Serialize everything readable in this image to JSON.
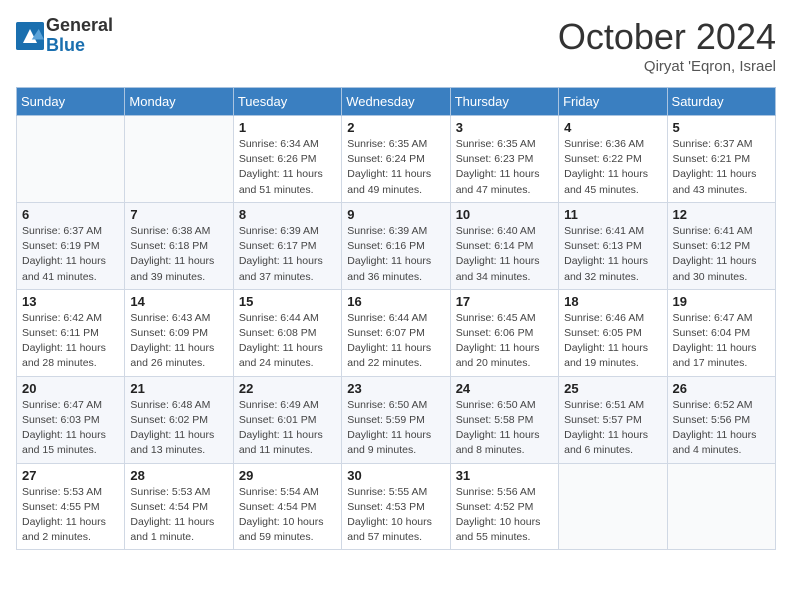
{
  "header": {
    "logo_line1": "General",
    "logo_line2": "Blue",
    "month_title": "October 2024",
    "subtitle": "Qiryat 'Eqron, Israel"
  },
  "days_of_week": [
    "Sunday",
    "Monday",
    "Tuesday",
    "Wednesday",
    "Thursday",
    "Friday",
    "Saturday"
  ],
  "weeks": [
    [
      {
        "day": "",
        "info": ""
      },
      {
        "day": "",
        "info": ""
      },
      {
        "day": "1",
        "info": "Sunrise: 6:34 AM\nSunset: 6:26 PM\nDaylight: 11 hours and 51 minutes."
      },
      {
        "day": "2",
        "info": "Sunrise: 6:35 AM\nSunset: 6:24 PM\nDaylight: 11 hours and 49 minutes."
      },
      {
        "day": "3",
        "info": "Sunrise: 6:35 AM\nSunset: 6:23 PM\nDaylight: 11 hours and 47 minutes."
      },
      {
        "day": "4",
        "info": "Sunrise: 6:36 AM\nSunset: 6:22 PM\nDaylight: 11 hours and 45 minutes."
      },
      {
        "day": "5",
        "info": "Sunrise: 6:37 AM\nSunset: 6:21 PM\nDaylight: 11 hours and 43 minutes."
      }
    ],
    [
      {
        "day": "6",
        "info": "Sunrise: 6:37 AM\nSunset: 6:19 PM\nDaylight: 11 hours and 41 minutes."
      },
      {
        "day": "7",
        "info": "Sunrise: 6:38 AM\nSunset: 6:18 PM\nDaylight: 11 hours and 39 minutes."
      },
      {
        "day": "8",
        "info": "Sunrise: 6:39 AM\nSunset: 6:17 PM\nDaylight: 11 hours and 37 minutes."
      },
      {
        "day": "9",
        "info": "Sunrise: 6:39 AM\nSunset: 6:16 PM\nDaylight: 11 hours and 36 minutes."
      },
      {
        "day": "10",
        "info": "Sunrise: 6:40 AM\nSunset: 6:14 PM\nDaylight: 11 hours and 34 minutes."
      },
      {
        "day": "11",
        "info": "Sunrise: 6:41 AM\nSunset: 6:13 PM\nDaylight: 11 hours and 32 minutes."
      },
      {
        "day": "12",
        "info": "Sunrise: 6:41 AM\nSunset: 6:12 PM\nDaylight: 11 hours and 30 minutes."
      }
    ],
    [
      {
        "day": "13",
        "info": "Sunrise: 6:42 AM\nSunset: 6:11 PM\nDaylight: 11 hours and 28 minutes."
      },
      {
        "day": "14",
        "info": "Sunrise: 6:43 AM\nSunset: 6:09 PM\nDaylight: 11 hours and 26 minutes."
      },
      {
        "day": "15",
        "info": "Sunrise: 6:44 AM\nSunset: 6:08 PM\nDaylight: 11 hours and 24 minutes."
      },
      {
        "day": "16",
        "info": "Sunrise: 6:44 AM\nSunset: 6:07 PM\nDaylight: 11 hours and 22 minutes."
      },
      {
        "day": "17",
        "info": "Sunrise: 6:45 AM\nSunset: 6:06 PM\nDaylight: 11 hours and 20 minutes."
      },
      {
        "day": "18",
        "info": "Sunrise: 6:46 AM\nSunset: 6:05 PM\nDaylight: 11 hours and 19 minutes."
      },
      {
        "day": "19",
        "info": "Sunrise: 6:47 AM\nSunset: 6:04 PM\nDaylight: 11 hours and 17 minutes."
      }
    ],
    [
      {
        "day": "20",
        "info": "Sunrise: 6:47 AM\nSunset: 6:03 PM\nDaylight: 11 hours and 15 minutes."
      },
      {
        "day": "21",
        "info": "Sunrise: 6:48 AM\nSunset: 6:02 PM\nDaylight: 11 hours and 13 minutes."
      },
      {
        "day": "22",
        "info": "Sunrise: 6:49 AM\nSunset: 6:01 PM\nDaylight: 11 hours and 11 minutes."
      },
      {
        "day": "23",
        "info": "Sunrise: 6:50 AM\nSunset: 5:59 PM\nDaylight: 11 hours and 9 minutes."
      },
      {
        "day": "24",
        "info": "Sunrise: 6:50 AM\nSunset: 5:58 PM\nDaylight: 11 hours and 8 minutes."
      },
      {
        "day": "25",
        "info": "Sunrise: 6:51 AM\nSunset: 5:57 PM\nDaylight: 11 hours and 6 minutes."
      },
      {
        "day": "26",
        "info": "Sunrise: 6:52 AM\nSunset: 5:56 PM\nDaylight: 11 hours and 4 minutes."
      }
    ],
    [
      {
        "day": "27",
        "info": "Sunrise: 5:53 AM\nSunset: 4:55 PM\nDaylight: 11 hours and 2 minutes."
      },
      {
        "day": "28",
        "info": "Sunrise: 5:53 AM\nSunset: 4:54 PM\nDaylight: 11 hours and 1 minute."
      },
      {
        "day": "29",
        "info": "Sunrise: 5:54 AM\nSunset: 4:54 PM\nDaylight: 10 hours and 59 minutes."
      },
      {
        "day": "30",
        "info": "Sunrise: 5:55 AM\nSunset: 4:53 PM\nDaylight: 10 hours and 57 minutes."
      },
      {
        "day": "31",
        "info": "Sunrise: 5:56 AM\nSunset: 4:52 PM\nDaylight: 10 hours and 55 minutes."
      },
      {
        "day": "",
        "info": ""
      },
      {
        "day": "",
        "info": ""
      }
    ]
  ]
}
